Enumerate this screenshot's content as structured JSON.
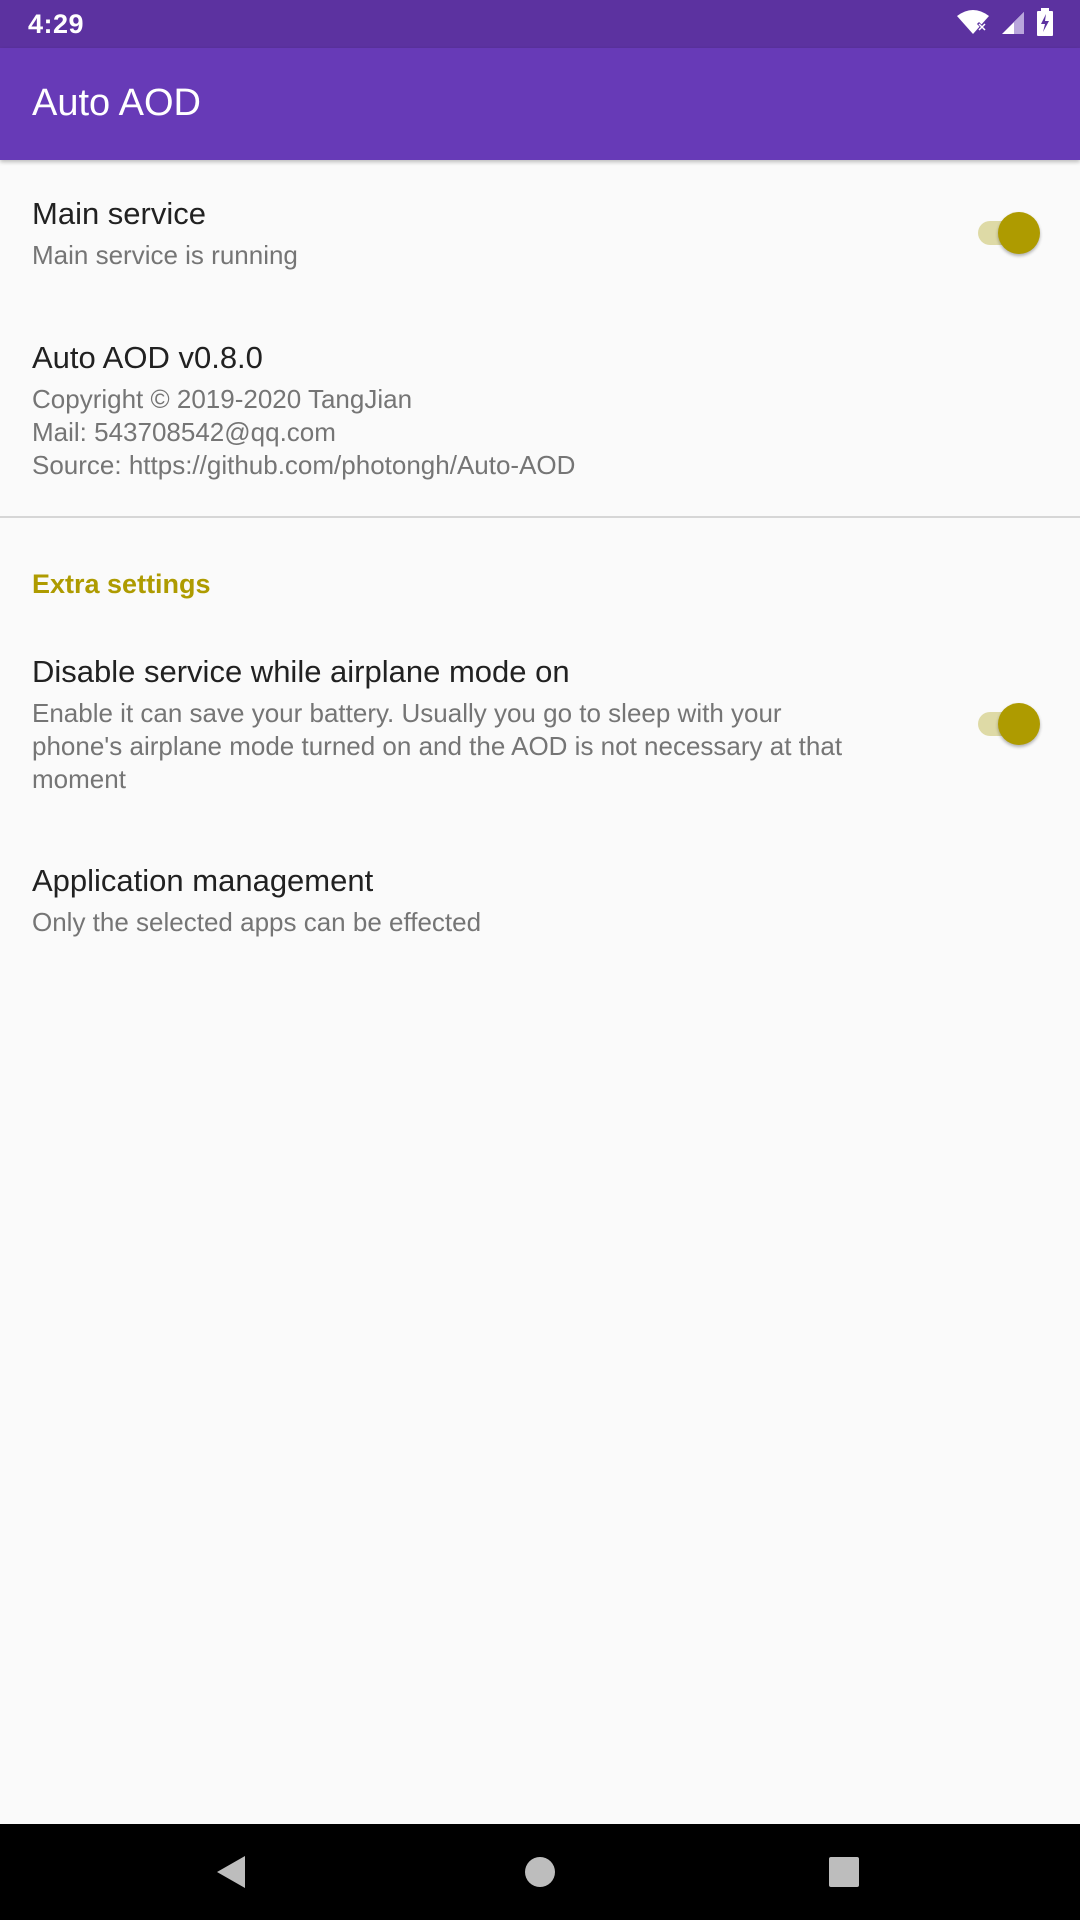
{
  "status_bar": {
    "time": "4:29",
    "icons": [
      "wifi-icon",
      "cell-signal-icon",
      "battery-charging-icon"
    ]
  },
  "app_bar": {
    "title": "Auto AOD"
  },
  "preferences": {
    "main_service": {
      "title": "Main service",
      "summary": "Main service is running",
      "enabled": true
    },
    "about": {
      "title": "Auto AOD v0.8.0",
      "copyright": "Copyright © 2019-2020 TangJian",
      "mail": "Mail: 543708542@qq.com",
      "source": "Source: https://github.com/photongh/Auto-AOD"
    },
    "extra_category": {
      "title": "Extra settings"
    },
    "airplane_mode": {
      "title": "Disable service while airplane mode on",
      "summary_lines": [
        "Enable it can save your battery. Usually you go to sleep with your",
        "phone's airplane mode turned on and the AOD is not necessary at that",
        "moment"
      ],
      "enabled": true
    },
    "app_management": {
      "title": "Application management",
      "summary": "Only the selected apps can be effected"
    }
  },
  "navigation": {
    "buttons": [
      "back-icon",
      "home-icon",
      "recents-icon"
    ]
  },
  "colors": {
    "status_bar": "#5c32a0",
    "app_bar": "#673ab7",
    "accent": "#ae9b00",
    "background": "#fafafa"
  }
}
